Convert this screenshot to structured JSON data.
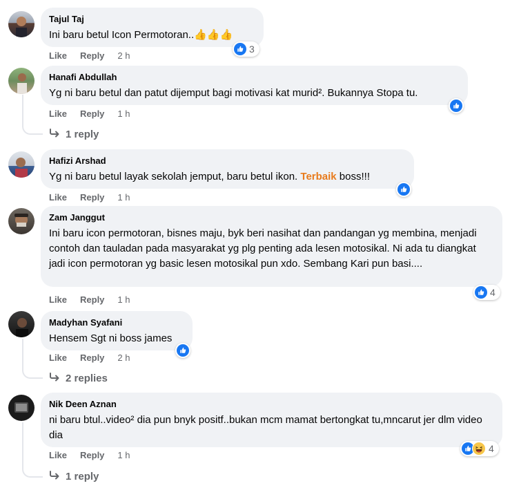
{
  "comments": [
    {
      "author": "Tajul Taj",
      "text": "Ini baru betul Icon Permotoran..",
      "emoji": "👍👍👍",
      "actions": {
        "like": "Like",
        "reply": "Reply",
        "time": "2 h"
      },
      "reaction_count": "3"
    },
    {
      "author": "Hanafi Abdullah",
      "text": "Yg ni baru betul dan patut dijemput bagi motivasi kat murid². Bukannya Stopa tu.",
      "actions": {
        "like": "Like",
        "reply": "Reply",
        "time": "1 h"
      },
      "replies_label": "1 reply"
    },
    {
      "author": "Hafizi Arshad",
      "text_before": "Yg ni baru betul layak sekolah jemput, baru betul ikon. ",
      "text_highlight": "Terbaik",
      "text_after": " boss!!!",
      "actions": {
        "like": "Like",
        "reply": "Reply",
        "time": "1 h"
      }
    },
    {
      "author": "Zam Janggut",
      "text": "Ini baru icon permotoran, bisnes maju, byk beri nasihat dan pandangan yg membina, menjadi contoh dan tauladan pada masyarakat yg plg penting ada lesen motosikal. Ni ada tu diangkat jadi icon permotoran yg basic lesen motosikal pun xdo. Sembang Kari pun basi....",
      "actions": {
        "like": "Like",
        "reply": "Reply",
        "time": "1 h"
      },
      "reaction_count": "4"
    },
    {
      "author": "Madyhan Syafani",
      "text": "Hensem Sgt ni boss james",
      "actions": {
        "like": "Like",
        "reply": "Reply",
        "time": "2 h"
      },
      "replies_label": "2 replies"
    },
    {
      "author": "Nik Deen Aznan",
      "text": "ni baru btul..video² dia pun bnyk positf..bukan mcm mamat bertongkat tu,mncarut jer dlm video dia",
      "actions": {
        "like": "Like",
        "reply": "Reply",
        "time": "1 h"
      },
      "reaction_count": "4",
      "replies_label": "1 reply"
    }
  ],
  "icons": {
    "reaction_like": "like-thumb-icon",
    "reaction_haha": "haha-face-icon",
    "reply_arrow": "reply-arrow-icon"
  },
  "colors": {
    "bubble": "#f0f2f5",
    "like_blue": "#1877f2",
    "secondary_text": "#65676b",
    "highlight": "#e87b1c"
  }
}
